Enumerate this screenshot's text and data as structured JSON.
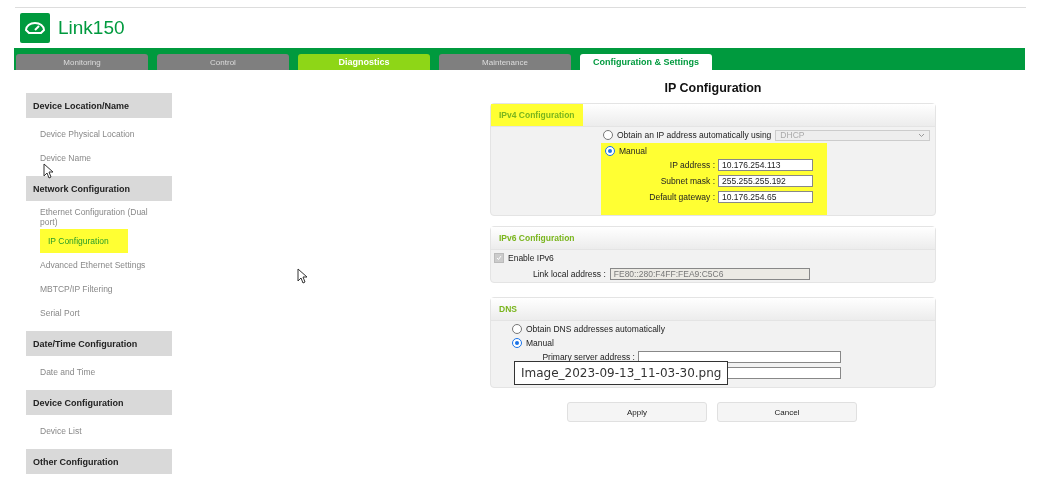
{
  "app": {
    "title": "Link150"
  },
  "tabs": [
    {
      "label": "Monitoring",
      "selected": false,
      "accent": false
    },
    {
      "label": "Control",
      "selected": false,
      "accent": false
    },
    {
      "label": "Diagnostics",
      "selected": false,
      "accent": true
    },
    {
      "label": "Maintenance",
      "selected": false,
      "accent": false
    },
    {
      "label": "Configuration & Settings",
      "selected": true,
      "accent": false
    }
  ],
  "sidebar": [
    {
      "title": "Device Location/Name",
      "items": [
        {
          "label": "Device Physical Location",
          "selected": false,
          "highlighted": false
        },
        {
          "label": "Device Name",
          "selected": false,
          "highlighted": false
        }
      ]
    },
    {
      "title": "Network Configuration",
      "items": [
        {
          "label": "Ethernet Configuration (Dual port)",
          "selected": false,
          "highlighted": false
        },
        {
          "label": "IP Configuration",
          "selected": true,
          "highlighted": true
        },
        {
          "label": "Advanced Ethernet Settings",
          "selected": false,
          "highlighted": false
        },
        {
          "label": "MBTCP/IP Filtering",
          "selected": false,
          "highlighted": false
        },
        {
          "label": "Serial Port",
          "selected": false,
          "highlighted": false
        }
      ]
    },
    {
      "title": "Date/Time Configuration",
      "items": [
        {
          "label": "Date and Time",
          "selected": false,
          "highlighted": false
        }
      ]
    },
    {
      "title": "Device Configuration",
      "items": [
        {
          "label": "Device List",
          "selected": false,
          "highlighted": false
        }
      ]
    },
    {
      "title": "Other Configuration"
    }
  ],
  "page_title": "IP Configuration",
  "ipv4": {
    "title": "IPv4 Configuration",
    "highlighted": true,
    "auto": {
      "label": "Obtain an IP address automatically using",
      "selected": false,
      "select_value": "DHCP"
    },
    "manual": {
      "label": "Manual",
      "selected": true,
      "highlighted": true
    },
    "fields": [
      {
        "label": "IP address :",
        "value": "10.176.254.113"
      },
      {
        "label": "Subnet mask :",
        "value": "255.255.255.192"
      },
      {
        "label": "Default gateway :",
        "value": "10.176.254.65"
      }
    ]
  },
  "ipv6": {
    "title": "IPv6 Configuration",
    "enable_label": "Enable IPv6",
    "enabled": true,
    "link_local_label": "Link local address :",
    "link_local_value": "FE80::280:F4FF:FEA9:C5C6"
  },
  "dns": {
    "title": "DNS",
    "auto": {
      "label": "Obtain DNS addresses automatically",
      "selected": false
    },
    "manual": {
      "label": "Manual",
      "selected": true
    },
    "fields": [
      {
        "kind": "input",
        "label": "Primary server address :"
      },
      {
        "kind": "input"
      }
    ]
  },
  "buttons": [
    "Apply",
    "Cancel"
  ],
  "tooltip": "Image_2023-09-13_11-03-30.png"
}
